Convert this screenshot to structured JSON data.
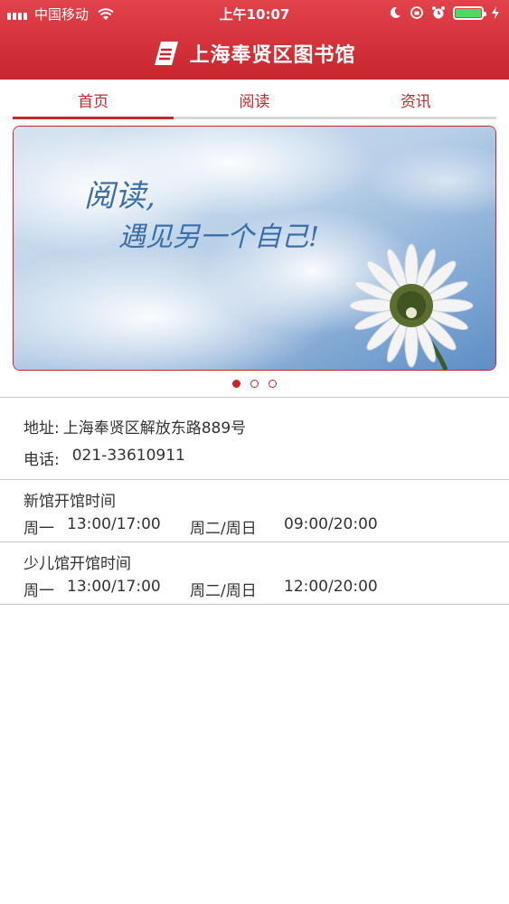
{
  "status_bar": {
    "carrier": "中国移动",
    "time": "上午10:07"
  },
  "nav": {
    "title": "上海奉贤区图书馆"
  },
  "tabs": [
    {
      "label": "首页",
      "active": true
    },
    {
      "label": "阅读",
      "active": false
    },
    {
      "label": "资讯",
      "active": false
    }
  ],
  "banner": {
    "line1": "阅读,",
    "line2": "遇见另一个自己!",
    "page_count": 3,
    "active_page": 1
  },
  "contact": {
    "address_label": "地址:",
    "address": "上海奉贤区解放东路889号",
    "phone_label": "电话:",
    "phone": "021-33610911"
  },
  "hours": [
    {
      "title": "新馆开馆时间",
      "day1": "周一",
      "time1": "13:00/17:00",
      "day2": "周二/周日",
      "time2": "09:00/20:00"
    },
    {
      "title": "少儿馆开馆时间",
      "day1": "周一",
      "time1": "13:00/17:00",
      "day2": "周二/周日",
      "time2": "12:00/20:00"
    }
  ],
  "colors": {
    "brand_red": "#c8262e",
    "divider": "#c9c9c9",
    "battery_green": "#4cd964"
  }
}
